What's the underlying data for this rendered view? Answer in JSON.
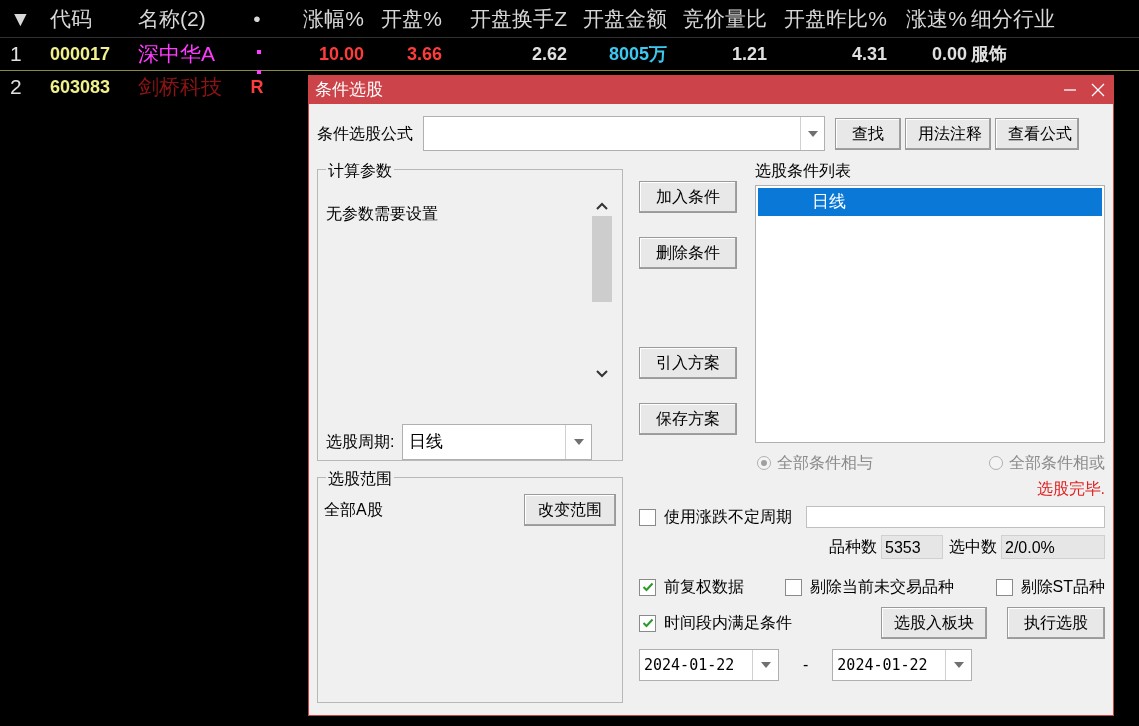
{
  "table": {
    "columns": [
      "▼",
      "代码",
      "名称(2)",
      "•",
      "涨幅%",
      "开盘%",
      "开盘换手Z",
      "开盘金额",
      "竞价量比",
      "开盘昨比%",
      "涨速%",
      "细分行业"
    ],
    "rows": [
      {
        "selected": true,
        "cells": [
          {
            "text": "1",
            "color": "#e0e0e0"
          },
          {
            "text": "000017",
            "color": "#f0f08c"
          },
          {
            "text": "深中华A",
            "color": "#ff3cff"
          },
          {
            "flag": true
          },
          {
            "text": "10.00",
            "color": "#ff3c3c"
          },
          {
            "text": "3.66",
            "color": "#ff3c3c"
          },
          {
            "text": "2.62",
            "color": "#e0e0e0"
          },
          {
            "text": "8005万",
            "color": "#3cc8f0"
          },
          {
            "text": "1.21",
            "color": "#e0e0e0"
          },
          {
            "text": "4.31",
            "color": "#e0e0e0"
          },
          {
            "text": "0.00",
            "color": "#e0e0e0"
          },
          {
            "text": "服饰",
            "color": "#e0e0e0"
          }
        ]
      },
      {
        "selected": false,
        "cells": [
          {
            "text": "2",
            "color": "#e0e0e0"
          },
          {
            "text": "603083",
            "color": "#f0f08c"
          },
          {
            "text": "剑桥科技",
            "color": "#8c1414"
          },
          {
            "text": "R",
            "flag": true,
            "color": "#ff3c3c"
          }
        ]
      }
    ]
  },
  "dialog": {
    "title": "条件选股",
    "formula_label": "条件选股公式",
    "top_buttons": [
      "查找",
      "用法注释",
      "查看公式"
    ],
    "params": {
      "title": "计算参数",
      "text": "无参数需要设置",
      "period_label": "选股周期:",
      "period_value": "日线"
    },
    "middle_buttons": [
      "加入条件",
      "删除条件",
      "引入方案",
      "保存方案"
    ],
    "conditions": {
      "title": "选股条件列表",
      "items": [
        {
          "text": "日线",
          "selected": true
        }
      ]
    },
    "logic": [
      {
        "label": "全部条件相与",
        "selected": true,
        "disabled": true
      },
      {
        "label": "全部条件相或",
        "selected": false,
        "disabled": true
      }
    ],
    "status": "选股完毕.",
    "range": {
      "title": "选股范围",
      "value": "全部A股",
      "button": "改变范围"
    },
    "variable_period": {
      "label": "使用涨跌不定周期",
      "checked": false
    },
    "counts": [
      {
        "label": "品种数",
        "value": "5353"
      },
      {
        "label": "选中数",
        "value": "2/0.0%"
      }
    ],
    "options": [
      {
        "label": "前复权数据",
        "checked": true
      },
      {
        "label": "剔除当前未交易品种",
        "checked": false
      },
      {
        "label": "剔除ST品种",
        "checked": false
      }
    ],
    "time_range": {
      "label": "时间段内满足条件",
      "checked": true
    },
    "action_buttons": [
      "选股入板块",
      "执行选股"
    ],
    "dates": {
      "start": "2024-01-22",
      "separator": "-",
      "end": "2024-01-22"
    }
  }
}
